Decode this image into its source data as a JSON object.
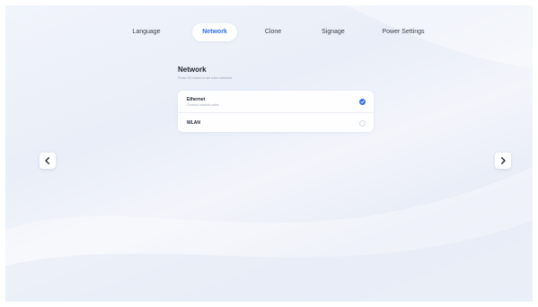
{
  "tabs": {
    "language": "Language",
    "network": "Network",
    "clone": "Clone",
    "signage": "Signage",
    "power": "Power Settings",
    "active": "Network"
  },
  "network": {
    "title": "Network",
    "hint": "Press OK button to set when selected",
    "options": [
      {
        "label": "Ethernet",
        "sub": "Connect network cable",
        "selected": true
      },
      {
        "label": "WLAN",
        "sub": "",
        "selected": false
      }
    ]
  },
  "icons": {
    "prev": "chevron-left-icon",
    "next": "chevron-right-icon",
    "selected": "check-icon"
  },
  "colors": {
    "accent": "#2f6fe3",
    "text": "#1f2430",
    "muted": "#9aa2b1"
  }
}
